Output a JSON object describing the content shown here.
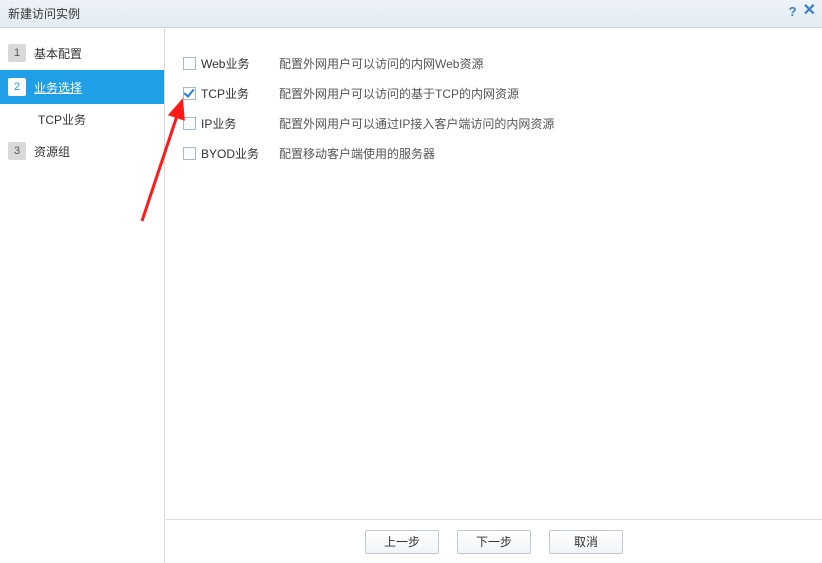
{
  "titlebar": {
    "title": "新建访问实例"
  },
  "sidebar": {
    "steps": [
      {
        "num": "1",
        "label": "基本配置"
      },
      {
        "num": "2",
        "label": "业务选择"
      },
      {
        "num": "3",
        "label": "资源组"
      }
    ],
    "substep_tcp": "TCP业务"
  },
  "services": [
    {
      "label": "Web业务",
      "checked": false,
      "desc": "配置外网用户可以访问的内网Web资源"
    },
    {
      "label": "TCP业务",
      "checked": true,
      "desc": "配置外网用户可以访问的基于TCP的内网资源"
    },
    {
      "label": "IP业务",
      "checked": false,
      "desc": "配置外网用户可以通过IP接入客户端访问的内网资源"
    },
    {
      "label": "BYOD业务",
      "checked": false,
      "desc": "配置移动客户端使用的服务器"
    }
  ],
  "footer": {
    "prev": "上一步",
    "next": "下一步",
    "cancel": "取消"
  }
}
